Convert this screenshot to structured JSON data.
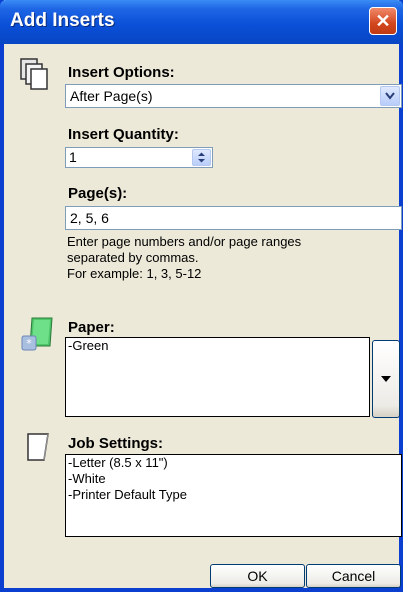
{
  "title": "Add Inserts",
  "insert_options": {
    "label": "Insert Options:",
    "selected": "After Page(s)"
  },
  "insert_quantity": {
    "label": "Insert Quantity:",
    "value": "1"
  },
  "pages": {
    "label": "Page(s):",
    "value": "2, 5, 6",
    "hint_line1": "Enter page numbers and/or page ranges",
    "hint_line2": "separated by commas.",
    "hint_line3": "For example: 1, 3, 5-12"
  },
  "paper": {
    "label": "Paper:",
    "items": [
      "-Green"
    ]
  },
  "job_settings": {
    "label": "Job Settings:",
    "items": [
      "-Letter (8.5 x 11\")",
      "-White",
      "-Printer Default Type"
    ]
  },
  "buttons": {
    "ok": "OK",
    "cancel": "Cancel"
  },
  "icons": {
    "close": "close-icon",
    "insert": "page-stack-icon",
    "paper": "paper-swatch-icon",
    "job": "blank-page-icon"
  },
  "colors": {
    "titlebar": "#0a50d8",
    "background": "#ece9d8",
    "close": "#d3461e",
    "paper_swatch": "#4fc66a"
  }
}
